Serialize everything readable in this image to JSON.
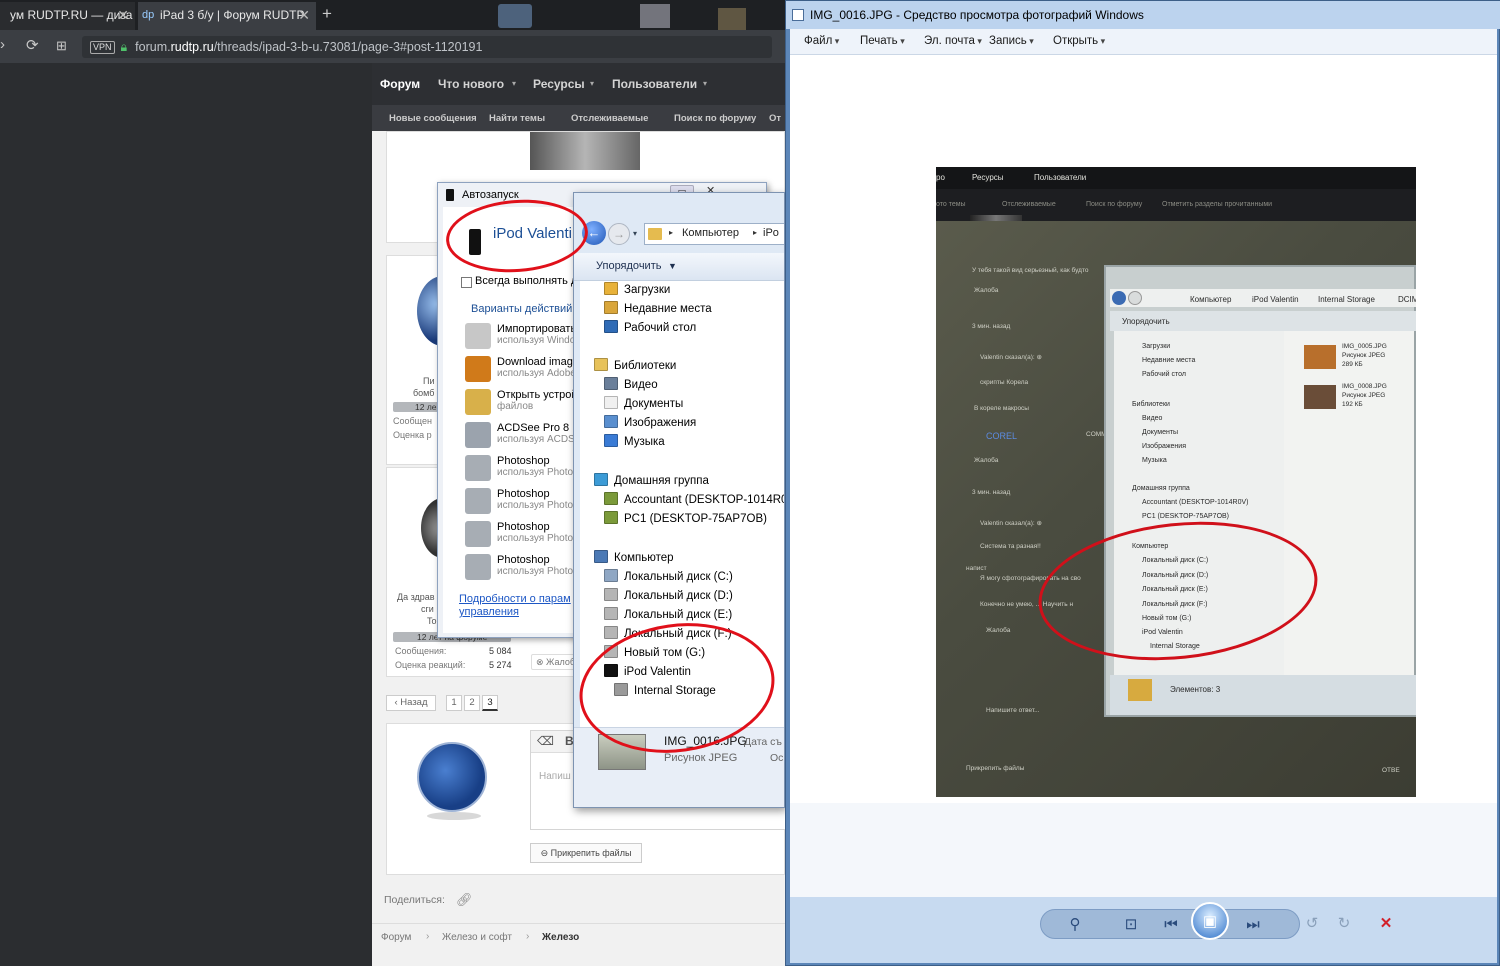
{
  "browser": {
    "tabs": [
      {
        "title": "ум RUDTP.RU — диза",
        "active": false
      },
      {
        "title": "iPad 3 б/у | Форум RUDTP",
        "active": true
      }
    ],
    "url_prefix": "forum.",
    "url_domain": "rudtp.ru",
    "url_path": "/threads/ipad-3-b-u.73081/page-3#post-1120191",
    "vpn_label": "VPN"
  },
  "forum": {
    "nav": [
      "Форум",
      "Что нового",
      "Ресурсы",
      "Пользователи"
    ],
    "subnav": [
      "Новые сообщения",
      "Найти темы",
      "Отслеживаемые",
      "Поиск по форуму",
      "От"
    ],
    "user2": {
      "name_lines": [
        "Да здрав",
        "сги",
        "To"
      ],
      "tenure": "12 лет на форуме",
      "messages_label": "Сообщения:",
      "messages_value": "5 084",
      "reactions_label": "Оценка реакций:",
      "reactions_value": "5 274",
      "complaint": "Жалоб"
    },
    "user1": {
      "name_lines": [
        "Пи",
        "бомб"
      ],
      "tenure": "12 ле",
      "messages_label": "Сообщен",
      "reactions_label": "Оценка р"
    },
    "pagination": {
      "back": "‹ Назад",
      "pages": [
        "1",
        "2",
        "3"
      ]
    },
    "reply_placeholder": "Напиш",
    "attach_button": "Прикрепить файлы",
    "share_label": "Поделиться:",
    "breadcrumbs": [
      "Форум",
      "Железо и софт",
      "Железо"
    ]
  },
  "autoplay": {
    "title": "Автозапуск",
    "device": "iPod Valentin",
    "always_checkbox": "Всегда выполнять д",
    "options_heading": "Варианты действий д",
    "items": [
      {
        "title": "Импортировать и",
        "sub": "используя Windo"
      },
      {
        "title": "Download images",
        "sub": "используя Adobe"
      },
      {
        "title": "Открыть устрой",
        "sub": "файлов"
      },
      {
        "title": "ACDSee Pro 8",
        "sub": "используя ACDS"
      },
      {
        "title": "Photoshop",
        "sub": "используя Photo"
      },
      {
        "title": "Photoshop",
        "sub": "используя Photo"
      },
      {
        "title": "Photoshop",
        "sub": "используя Photo"
      },
      {
        "title": "Photoshop",
        "sub": "используя Photo"
      }
    ],
    "link_line1": "Подробности о парам",
    "link_line2": "управления"
  },
  "explorer": {
    "breadcrumb": [
      "Компьютер",
      "iPo"
    ],
    "organize": "Упорядочить",
    "tree": [
      {
        "label": "Загрузки",
        "indent": 1,
        "color": "#e8b23a"
      },
      {
        "label": "Недавние места",
        "indent": 1,
        "color": "#d9a63b"
      },
      {
        "label": "Рабочий стол",
        "indent": 1,
        "color": "#2f6bb6"
      },
      {
        "label": "Библиотеки",
        "indent": 0,
        "color": "#e7c25a"
      },
      {
        "label": "Видео",
        "indent": 1,
        "color": "#6a7f9a"
      },
      {
        "label": "Документы",
        "indent": 1,
        "color": "#f0f0f0"
      },
      {
        "label": "Изображения",
        "indent": 1,
        "color": "#5a8fcf"
      },
      {
        "label": "Музыка",
        "indent": 1,
        "color": "#3a7bd5"
      },
      {
        "label": "Домашняя группа",
        "indent": 0,
        "color": "#3c9bd6"
      },
      {
        "label": "Accountant (DESKTOP-1014R0V)",
        "indent": 1,
        "color": "#7b9a3a"
      },
      {
        "label": "PC1 (DESKTOP-75AP7OB)",
        "indent": 1,
        "color": "#7b9a3a"
      },
      {
        "label": "Компьютер",
        "indent": 0,
        "color": "#4b79b5"
      },
      {
        "label": "Локальный диск (C:)",
        "indent": 1,
        "color": "#8fa7c4"
      },
      {
        "label": "Локальный диск (D:)",
        "indent": 1,
        "color": "#b5b5b5"
      },
      {
        "label": "Локальный диск (E:)",
        "indent": 1,
        "color": "#b5b5b5"
      },
      {
        "label": "Локальный диск (F:)",
        "indent": 1,
        "color": "#b5b5b5"
      },
      {
        "label": "Новый том (G:)",
        "indent": 1,
        "color": "#b5b5b5"
      },
      {
        "label": "iPod Valentin",
        "indent": 1,
        "color": "#111111"
      },
      {
        "label": "Internal Storage",
        "indent": 2,
        "color": "#9a9a9a"
      }
    ],
    "file_name": "IMG_0016.JPG",
    "file_type": "Рисунок JPEG",
    "file_date_label": "Дата съ",
    "file_extra": "Ос"
  },
  "viewer": {
    "title": "IMG_0016.JPG - Средство просмотра фотографий Windows",
    "menu": [
      "Файл",
      "Печать",
      "Эл. почта",
      "Запись",
      "Открыть"
    ],
    "photo_text": {
      "nav": [
        "ро",
        "Ресурсы",
        "Пользователи"
      ],
      "subnav": [
        "ото темы",
        "Отслеживаемые",
        "Поиск по форуму",
        "Отметить разделы прочитанными"
      ],
      "breadcrumb": [
        "Компьютер",
        "iPod Valentin",
        "Internal Storage",
        "DCIM"
      ],
      "organize": "Упорядочить",
      "tree": [
        "Загрузки",
        "Недавние места",
        "Рабочий стол",
        "Библиотеки",
        "Видео",
        "Документы",
        "Изображения",
        "Музыка",
        "Домашняя группа",
        "Accountant (DESKTOP-1014R0V)",
        "PC1 (DESKTOP-75AP7OB)",
        "Компьютер",
        "Локальный диск (C:)",
        "Локальный диск (D:)",
        "Локальный диск (E:)",
        "Локальный диск (F:)",
        "Новый том (G:)",
        "iPod Valentin",
        "Internal Storage"
      ],
      "files": [
        {
          "name": "IMG_0005.JPG",
          "type": "Рисунок JPEG",
          "size": "289 КБ"
        },
        {
          "name": "IMG_0008.JPG",
          "type": "Рисунок JPEG",
          "size": "192 КБ"
        }
      ],
      "elements": "Элементов: 3",
      "forum_bits": [
        "У тебя такой вид серьезный, как будто",
        "Жалоба",
        "3 мин. назад",
        "Valentin сказал(а): ⊕",
        "скрипты Корела",
        "В кореле макросы",
        "COREL",
        "COMMUNITY PROFESSI",
        "Жалоба",
        "3 мин. назад",
        "Valentin сказал(а): ⊕",
        "Система та разная!!",
        "напист",
        "Я могу сфотографировать на сво",
        "Конечно не умею, ... Научить н",
        "Жалоба",
        "Напишите ответ...",
        "Прикрепить файлы",
        "ОТВЕ"
      ]
    }
  },
  "colors": {
    "ring": "#e0101a",
    "forum_nav": "#2d2f33",
    "viewer_frame": "#5c86b8"
  }
}
